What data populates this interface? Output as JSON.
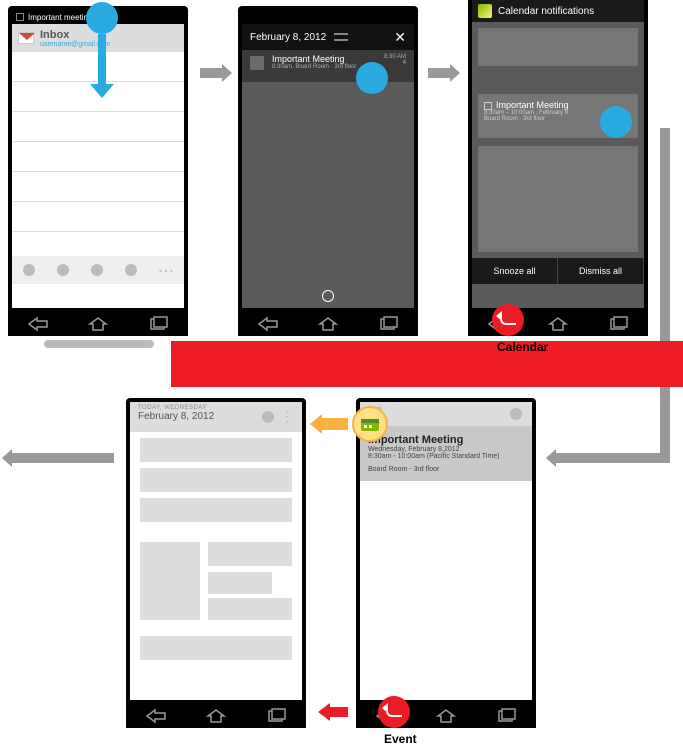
{
  "screen1": {
    "status_text": "Important meeting",
    "inbox_label": "Inbox",
    "inbox_account": "username@gmail.com"
  },
  "screen2": {
    "date": "February 8, 2012",
    "notif_title": "Important Meeting",
    "notif_sub": "8:30am, Board Room · 3rd floor",
    "notif_time": "8:30 AM",
    "notif_count": "4"
  },
  "screen3": {
    "header": "Calendar notifications",
    "item_title": "Important Meeting",
    "item_sub": "8:30am – 10:00am , February 8",
    "item_loc": "Board Room - 3rd floor",
    "snooze": "Snooze all",
    "dismiss": "Dismiss all"
  },
  "screen4": {
    "overline": "TODAY, WEDNESDAY",
    "date": "February 8, 2012"
  },
  "screen5": {
    "title": "Important Meeting",
    "line1": "Wednesday, February 8,2012",
    "line2": "8:30am - 10:00am (Pacific Standard Time)",
    "loc": "Board Room - 3rd floor"
  },
  "labels": {
    "calendar": "Calendar",
    "event": "Event"
  }
}
